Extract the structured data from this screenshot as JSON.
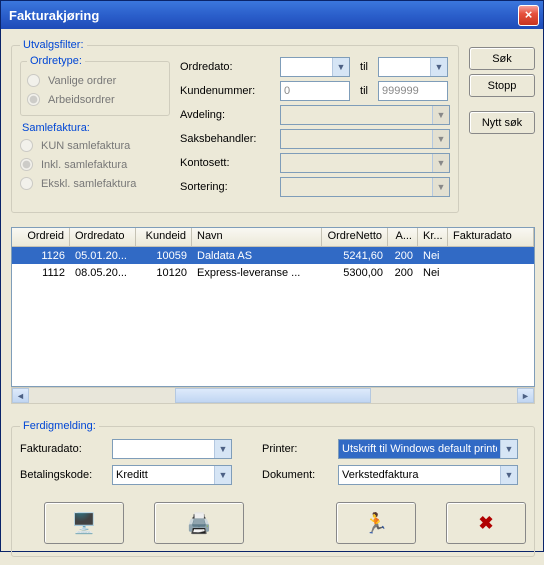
{
  "window": {
    "title": "Fakturakjøring"
  },
  "filter": {
    "legend": "Utvalgsfilter:",
    "ordretype": {
      "legend": "Ordretype:",
      "vanlige": "Vanlige ordrer",
      "arbeids": "Arbeidsordrer"
    },
    "samlefaktura": {
      "legend": "Samlefaktura:",
      "kun": "KUN samlefaktura",
      "inkl": "Inkl. samlefaktura",
      "ekskl": "Ekskl. samlefaktura"
    },
    "labels": {
      "ordredato": "Ordredato:",
      "kundenummer": "Kundenummer:",
      "avdeling": "Avdeling:",
      "saksbehandler": "Saksbehandler:",
      "kontosett": "Kontosett:",
      "sortering": "Sortering:"
    },
    "til": "til",
    "kundenummer_from": "0",
    "kundenummer_to": "999999"
  },
  "buttons": {
    "sok": "Søk",
    "stopp": "Stopp",
    "nytt_sok": "Nytt søk"
  },
  "grid": {
    "headers": {
      "ordreid": "Ordreid",
      "ordredato": "Ordredato",
      "kundeid": "Kundeid",
      "navn": "Navn",
      "ordrenetto": "OrdreNetto",
      "a": "A...",
      "kr": "Kr...",
      "fakturadato": "Fakturadato"
    },
    "rows": [
      {
        "ordreid": "1126",
        "ordredato": "05.01.20...",
        "kundeid": "10059",
        "navn": "Daldata AS",
        "ordrenetto": "5241,60",
        "a": "200",
        "kr": "Nei",
        "fakturadato": ""
      },
      {
        "ordreid": "1112",
        "ordredato": "08.05.20...",
        "kundeid": "10120",
        "navn": "Express-leveranse ...",
        "ordrenetto": "5300,00",
        "a": "200",
        "kr": "Nei",
        "fakturadato": ""
      }
    ]
  },
  "bottom": {
    "legend": "Ferdigmelding:",
    "labels": {
      "fakturadato": "Fakturadato:",
      "betalingskode": "Betalingskode:",
      "printer": "Printer:",
      "dokument": "Dokument:"
    },
    "betalingskode": "Kreditt",
    "printer": "Utskrift til Windows default printer",
    "dokument": "Verkstedfaktura"
  }
}
